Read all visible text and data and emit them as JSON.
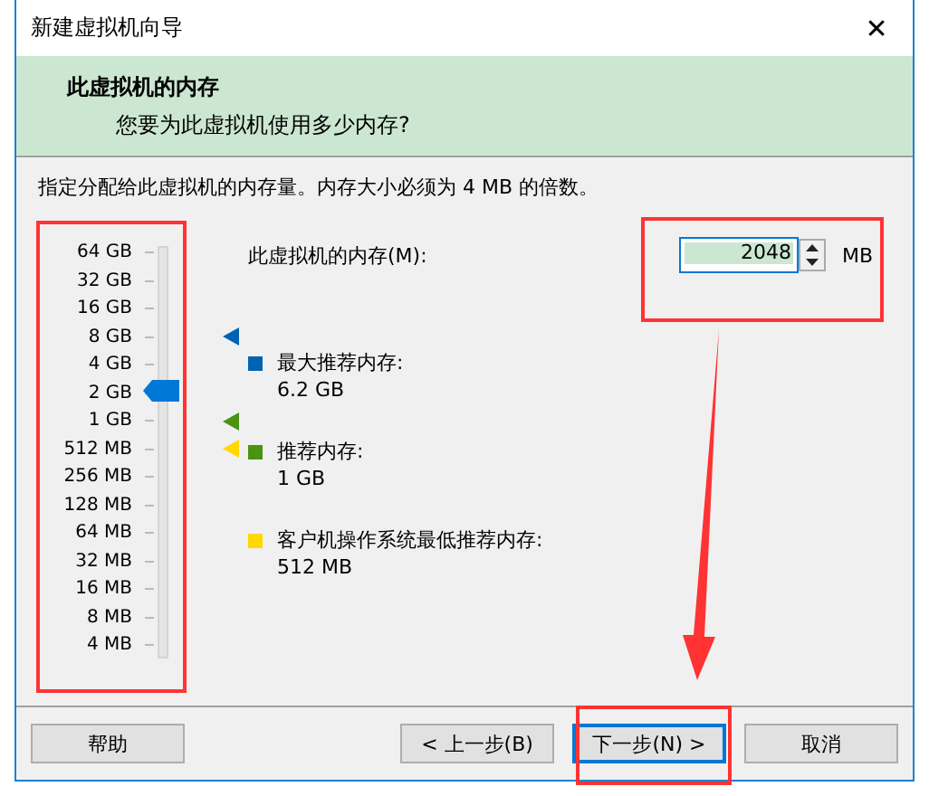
{
  "window": {
    "title": "新建虚拟机向导",
    "close": "✕"
  },
  "header": {
    "title": "此虚拟机的内存",
    "subtitle": "您要为此虚拟机使用多少内存?"
  },
  "description": "指定分配给此虚拟机的内存量。内存大小必须为 4 MB 的倍数。",
  "slider": {
    "ticks": [
      {
        "label": "64 GB"
      },
      {
        "label": "32 GB"
      },
      {
        "label": "16 GB"
      },
      {
        "label": "8 GB",
        "color": "#0063b1"
      },
      {
        "label": "4 GB"
      },
      {
        "label": "2 GB"
      },
      {
        "label": "1 GB",
        "color": "#4a9414"
      },
      {
        "label": "512 MB",
        "color": "#ffd800"
      },
      {
        "label": "256 MB"
      },
      {
        "label": "128 MB"
      },
      {
        "label": "64 MB"
      },
      {
        "label": "32 MB"
      },
      {
        "label": "16 MB"
      },
      {
        "label": "8 MB"
      },
      {
        "label": "4 MB"
      }
    ],
    "level": 0.643
  },
  "memory_field": {
    "label": "此虚拟机的内存(M):",
    "value": "2048",
    "unit": "MB"
  },
  "legend": [
    {
      "label": "最大推荐内存:",
      "value": "6.2 GB",
      "color": "#0063b1"
    },
    {
      "label": "推荐内存:",
      "value": "1 GB",
      "color": "#4a9414"
    },
    {
      "label": "客户机操作系统最低推荐内存:",
      "value": "512 MB",
      "color": "#ffd800"
    }
  ],
  "buttons": [
    {
      "label": "帮助",
      "focused": false
    },
    {
      "label": "< 上一步(B)",
      "focused": false
    },
    {
      "label": "下一步(N) >",
      "focused": true
    },
    {
      "label": "取消",
      "focused": false
    }
  ]
}
